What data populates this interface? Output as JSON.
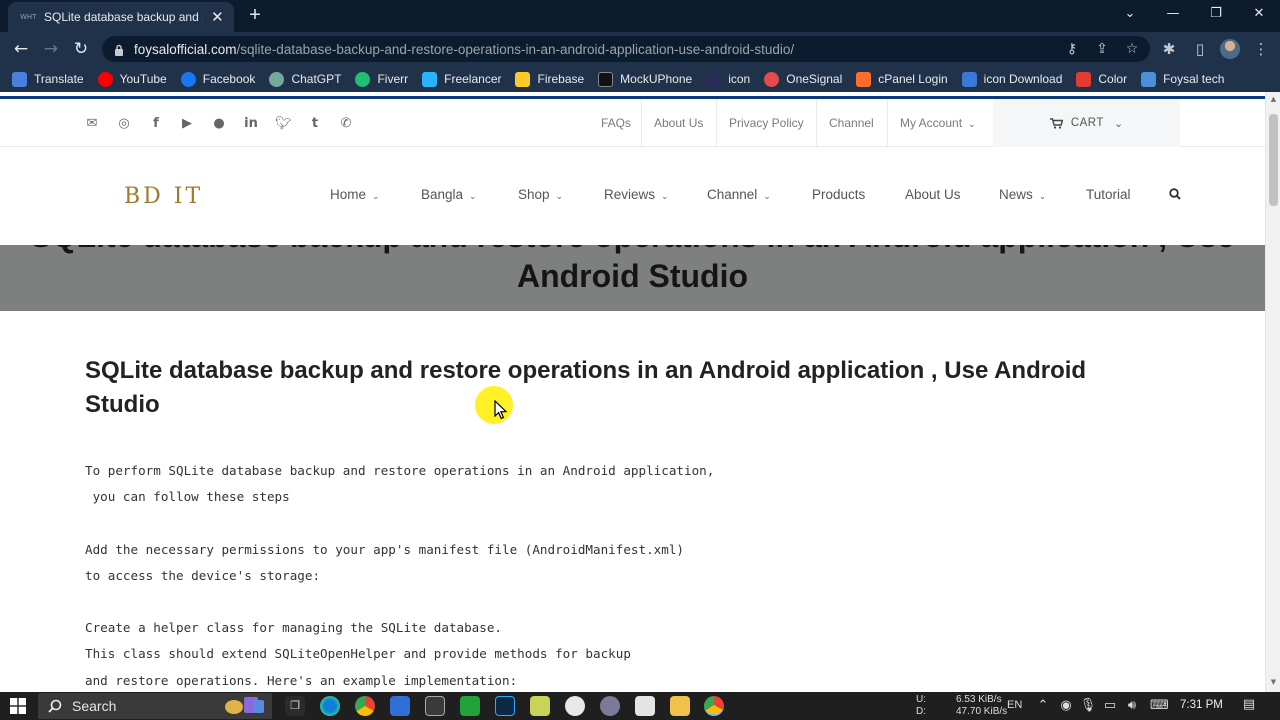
{
  "browser": {
    "tab_title": "SQLite database backup and rest",
    "tab_favicon_text": "WHT",
    "new_tab": "+",
    "url_host": "foysalofficial.com",
    "url_path": "/sqlite-database-backup-and-restore-operations-in-an-android-application-use-android-studio/",
    "bookmarks": [
      {
        "label": "Translate",
        "color": "#4a7fe0"
      },
      {
        "label": "YouTube",
        "color": "#ff0000"
      },
      {
        "label": "Facebook",
        "color": "#1877f2"
      },
      {
        "label": "ChatGPT",
        "color": "#74aa9c"
      },
      {
        "label": "Fiverr",
        "color": "#1dbf73"
      },
      {
        "label": "Freelancer",
        "color": "#29b2fe"
      },
      {
        "label": "Firebase",
        "color": "#ffca28"
      },
      {
        "label": "MockUPhone",
        "color": "#111111"
      },
      {
        "label": "icon",
        "color": "#2b2b5a"
      },
      {
        "label": "OneSignal",
        "color": "#e54b4d"
      },
      {
        "label": "cPanel Login",
        "color": "#ff6c2c"
      },
      {
        "label": "icon Download",
        "color": "#3a78d8"
      },
      {
        "label": "Color",
        "color": "#e33b2f"
      },
      {
        "label": "Foysal tech",
        "color": "#4a90d9"
      }
    ]
  },
  "site": {
    "top_links": [
      "FAQs",
      "About Us",
      "Privacy Policy",
      "Channel",
      "My Account"
    ],
    "cart_label": "CART",
    "logo_text": "BD IT",
    "nav": [
      {
        "label": "Home",
        "has_dropdown": true
      },
      {
        "label": "Bangla",
        "has_dropdown": true
      },
      {
        "label": "Shop",
        "has_dropdown": true
      },
      {
        "label": "Reviews",
        "has_dropdown": true
      },
      {
        "label": "Channel",
        "has_dropdown": true
      },
      {
        "label": "Products",
        "has_dropdown": false
      },
      {
        "label": "About Us",
        "has_dropdown": false
      },
      {
        "label": "News",
        "has_dropdown": true
      },
      {
        "label": "Tutorial",
        "has_dropdown": false
      }
    ],
    "hero_title": "SQLite database backup and restore operations in an Android application , Use Android Studio",
    "post_title": "SQLite database backup and restore operations in an Android application , Use Android Studio",
    "body_lines": [
      "To perform SQLite database backup and restore operations in an Android application,",
      " you can follow these steps",
      "",
      "Add the necessary permissions to your app's manifest file (AndroidManifest.xml)",
      "to access the device's storage:",
      "",
      "Create a helper class for managing the SQLite database.",
      "This class should extend SQLiteOpenHelper and provide methods for backup",
      "and restore operations. Here's an example implementation:"
    ],
    "accent_color": "#0a3a7a"
  },
  "taskbar": {
    "search_label": "Search",
    "upload_label": "U:",
    "upload_speed": "6.53 KiB/s",
    "download_label": "D:",
    "download_speed": "47.70 KiB/s",
    "language": "EN",
    "time": "7:31 PM"
  }
}
